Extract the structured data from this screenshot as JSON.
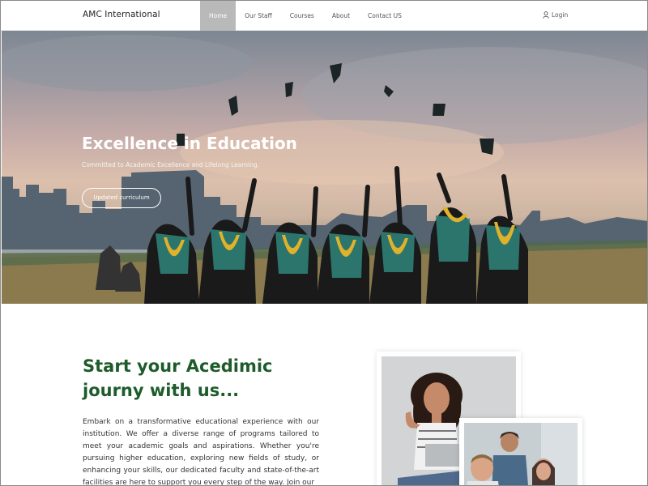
{
  "header": {
    "brand": "AMC International",
    "nav": [
      {
        "label": "Home",
        "active": true
      },
      {
        "label": "Our Staff"
      },
      {
        "label": "Courses"
      },
      {
        "label": "About"
      },
      {
        "label": "Contact US"
      }
    ],
    "login_label": "Login",
    "login_icon": "user-icon"
  },
  "hero": {
    "title": "Excellence in Education",
    "subtitle": "Committed to Academic Excellence and Lifelong Learning.",
    "button_label": "Updated curriculum"
  },
  "intro": {
    "heading": "Start your Acedimic journy with us...",
    "body": "Embark on a transformative educational experience with our institution. We offer a diverse range of programs tailored to meet your academic goals and aspirations. Whether you're pursuing higher education, exploring new fields of study, or enhancing your skills, our dedicated faculty and state-of-the-art facilities are here to support you every step of the way. Join our"
  },
  "colors": {
    "heading": "#1d5c2a",
    "nav_active_bg": "#b9b9b9"
  }
}
